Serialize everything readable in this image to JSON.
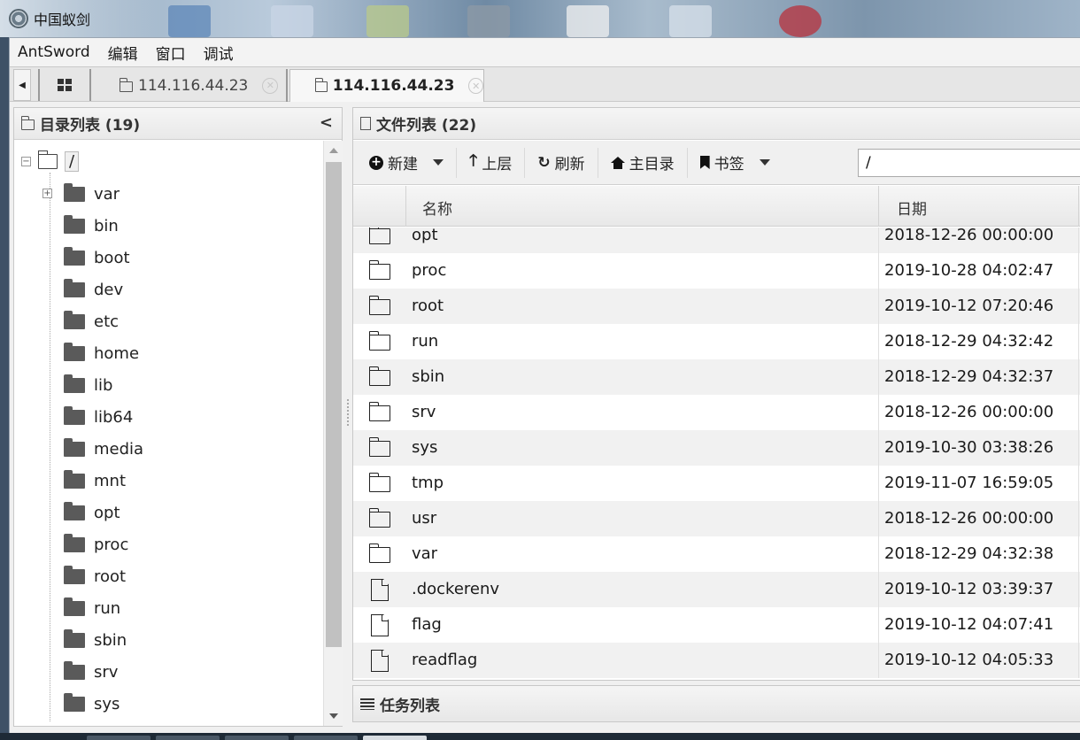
{
  "window": {
    "title": "中国蚁剑"
  },
  "menu": {
    "items": [
      "AntSword",
      "编辑",
      "窗口",
      "调试"
    ]
  },
  "tabs": [
    {
      "label": "114.116.44.23",
      "active": false
    },
    {
      "label": "114.116.44.23",
      "active": true
    }
  ],
  "left_panel": {
    "title": "目录列表 (19)",
    "root": "/",
    "folders": [
      "var",
      "bin",
      "boot",
      "dev",
      "etc",
      "home",
      "lib",
      "lib64",
      "media",
      "mnt",
      "opt",
      "proc",
      "root",
      "run",
      "sbin",
      "srv",
      "sys"
    ]
  },
  "right_panel": {
    "title": "文件列表 (22)",
    "toolbar": {
      "new_label": "新建",
      "up_label": "上层",
      "refresh_label": "刷新",
      "home_label": "主目录",
      "bookmark_label": "书签",
      "path_value": "/"
    },
    "columns": {
      "name": "名称",
      "date": "日期"
    },
    "files": [
      {
        "type": "folder",
        "name": "opt",
        "date": "2018-12-26 00:00:00"
      },
      {
        "type": "folder",
        "name": "proc",
        "date": "2019-10-28 04:02:47"
      },
      {
        "type": "folder",
        "name": "root",
        "date": "2019-10-12 07:20:46"
      },
      {
        "type": "folder",
        "name": "run",
        "date": "2018-12-29 04:32:42"
      },
      {
        "type": "folder",
        "name": "sbin",
        "date": "2018-12-29 04:32:37"
      },
      {
        "type": "folder",
        "name": "srv",
        "date": "2018-12-26 00:00:00"
      },
      {
        "type": "folder",
        "name": "sys",
        "date": "2019-10-30 03:38:26"
      },
      {
        "type": "folder",
        "name": "tmp",
        "date": "2019-11-07 16:59:05"
      },
      {
        "type": "folder",
        "name": "usr",
        "date": "2018-12-26 00:00:00"
      },
      {
        "type": "folder",
        "name": "var",
        "date": "2018-12-29 04:32:38"
      },
      {
        "type": "file",
        "name": ".dockerenv",
        "date": "2019-10-12 03:39:37"
      },
      {
        "type": "file",
        "name": "flag",
        "date": "2019-10-12 04:07:41"
      },
      {
        "type": "file",
        "name": "readflag",
        "date": "2019-10-12 04:05:33"
      }
    ]
  },
  "task_panel": {
    "title": "任务列表"
  }
}
